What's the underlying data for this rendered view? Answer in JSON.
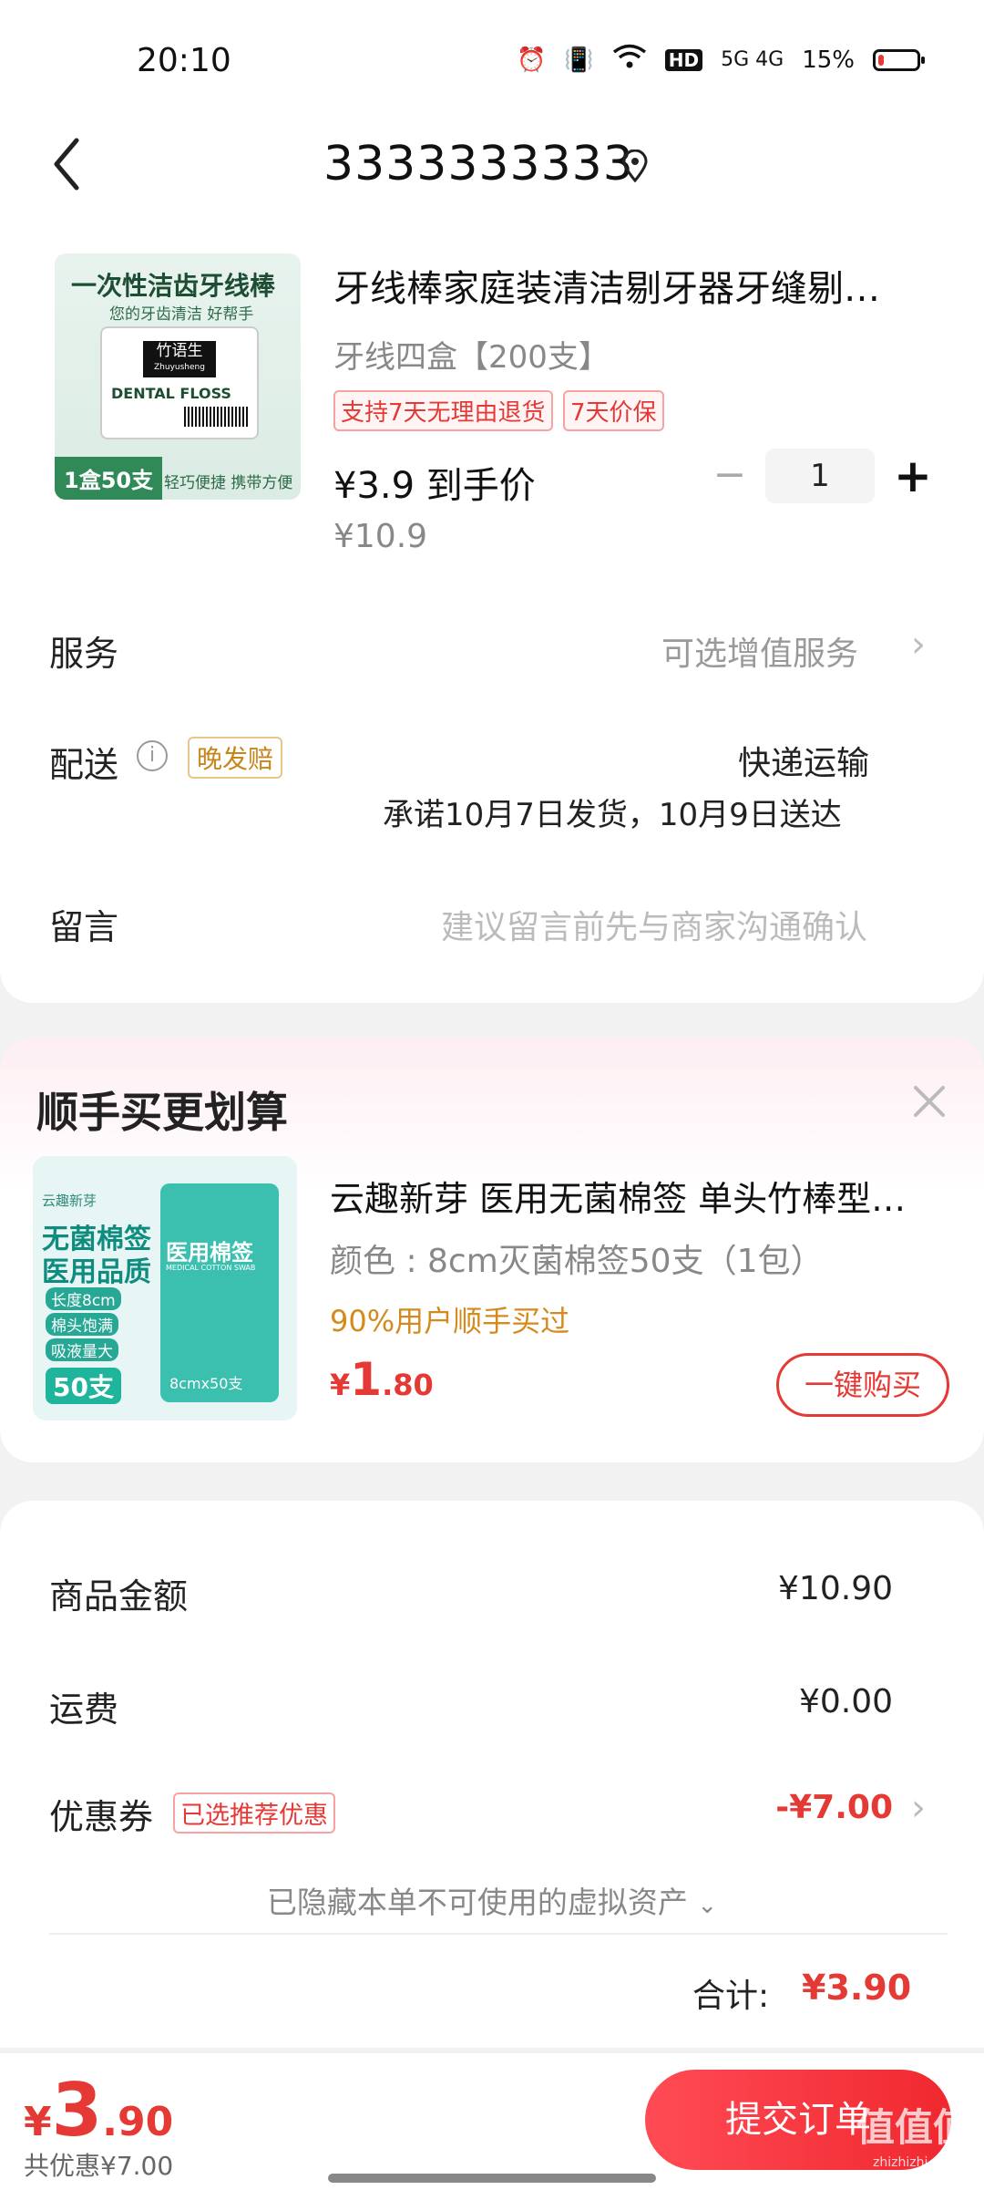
{
  "status_bar": {
    "time": "20:10",
    "network": "5G 4G",
    "battery": "15%",
    "battery_level": 0.15,
    "hd": "HD"
  },
  "header": {
    "title": "3333333333"
  },
  "product": {
    "title": "牙线棒家庭装清洁剔牙器牙缝剔…",
    "variant": "牙线四盒【200支】",
    "tags": [
      "支持7天无理由退货",
      "7天价保"
    ],
    "price_label": "¥3.9 到手价",
    "original_price": "¥10.9",
    "quantity": "1",
    "image_text": {
      "headline": "一次性洁齿牙线棒",
      "sub": "您的牙齿清洁 好帮手",
      "brand": "竹语生",
      "brand_en": "Zhuyusheng",
      "en": "DENTAL FLOSS",
      "count": "1盒50支",
      "slogan": "轻巧便捷 携带方便"
    }
  },
  "service": {
    "label": "服务",
    "value": "可选增值服务"
  },
  "delivery": {
    "label": "配送",
    "badge": "晚发赔",
    "method": "快递运输",
    "promise": "承诺10月7日发货，10月9日送达"
  },
  "message": {
    "label": "留言",
    "placeholder": "建议留言前先与商家沟通确认"
  },
  "recommend": {
    "title": "顺手买更划算",
    "product_title": "云趣新芽 医用无菌棉签 单头竹棒型…",
    "variant": "颜色 : 8cm灭菌棉签50支（1包）",
    "stat": "90%用户顺手买过",
    "price_symbol": "¥",
    "price_int": "1",
    "price_dec": ".80",
    "buy_label": "一键购买",
    "image_text": {
      "brand": "云趣新芽",
      "line1": "无菌棉签",
      "line2": "医用品质",
      "b1": "长度8cm",
      "b2": "棉头饱满",
      "b3": "吸液量大",
      "count": "50支",
      "pack": "医用棉签",
      "pack_en": "MEDICAL COTTON SWAB",
      "size": "8cmx50支"
    }
  },
  "summary": {
    "goods_label": "商品金额",
    "goods_value": "¥10.90",
    "shipping_label": "运费",
    "shipping_value": "¥0.00",
    "coupon_label": "优惠券",
    "coupon_badge": "已选推荐优惠",
    "coupon_value": "-¥7.00",
    "hidden_assets": "已隐藏本单不可使用的虚拟资产",
    "total_label": "合计:",
    "total_value": "¥3.90"
  },
  "bottom": {
    "price_symbol": "¥",
    "price_int": "3",
    "price_dec": ".90",
    "discount": "共优惠¥7.00",
    "submit": "提交订单",
    "watermark": "值值值",
    "watermark_url": "zhizhizhi.com"
  },
  "colors": {
    "accent": "#e53935",
    "orange": "#d48a1c"
  }
}
